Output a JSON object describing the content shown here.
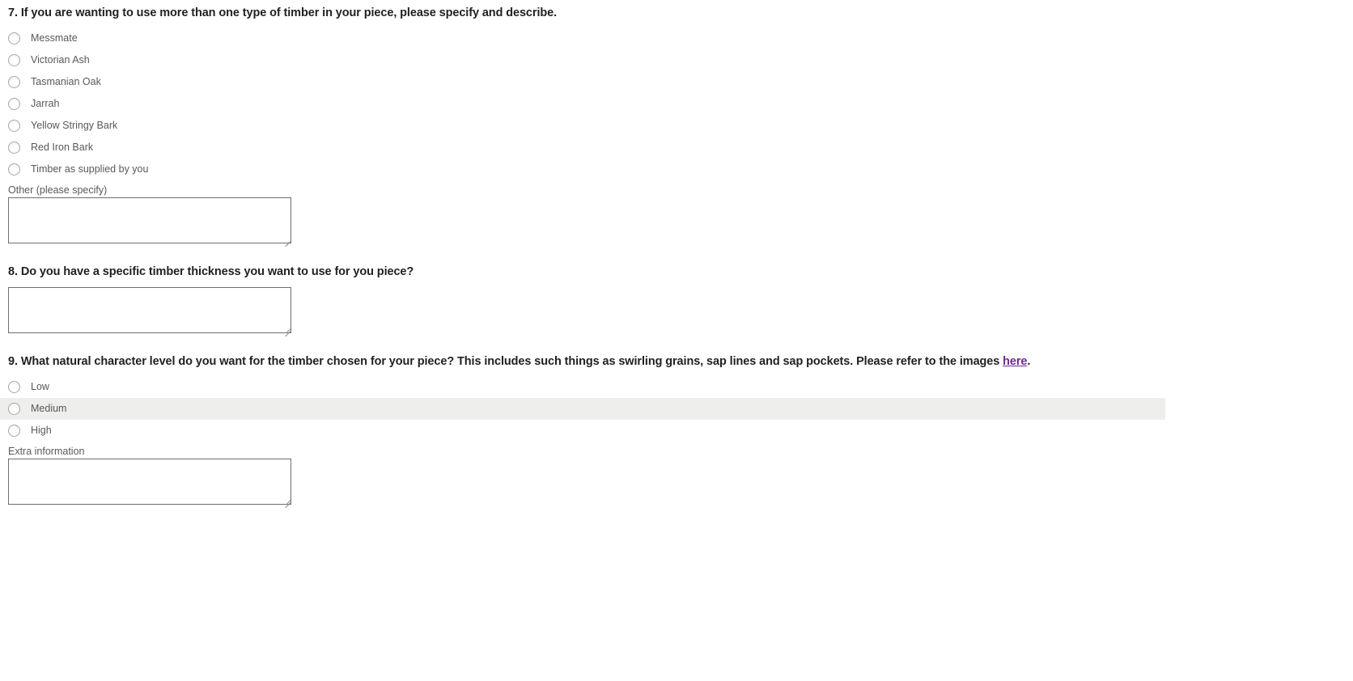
{
  "survey": {
    "questions": [
      {
        "number": "7.",
        "title": "7. If you are wanting to use more than one type of timber in your piece, please specify and describe.",
        "options": [
          {
            "label": "Messmate",
            "selected": false,
            "highlighted": false
          },
          {
            "label": "Victorian Ash",
            "selected": false,
            "highlighted": false
          },
          {
            "label": "Tasmanian Oak",
            "selected": false,
            "highlighted": false
          },
          {
            "label": "Jarrah",
            "selected": false,
            "highlighted": false
          },
          {
            "label": "Yellow Stringy Bark",
            "selected": false,
            "highlighted": false
          },
          {
            "label": "Red Iron Bark",
            "selected": false,
            "highlighted": false
          },
          {
            "label": "Timber as supplied by you",
            "selected": false,
            "highlighted": false
          }
        ],
        "other_label": "Other (please specify)",
        "other_value": "",
        "other_placeholder": ""
      },
      {
        "number": "8.",
        "title": "8. Do you have a specific timber thickness you want to use for you piece?",
        "answer_value": "",
        "answer_placeholder": ""
      },
      {
        "number": "9.",
        "title_part_1": "9. What natural character level do you want for the timber chosen for your piece? This includes such things as swirling grains, sap lines and sap pockets. Please refer to the images ",
        "link_text": "here",
        "title_part_2": ".",
        "options": [
          {
            "label": "Low",
            "selected": false,
            "highlighted": false
          },
          {
            "label": "Medium",
            "selected": false,
            "highlighted": true
          },
          {
            "label": "High",
            "selected": false,
            "highlighted": false
          }
        ],
        "extra_label": "Extra information",
        "extra_value": "",
        "extra_placeholder": ""
      }
    ]
  },
  "colors": {
    "heading_text": "#231f20",
    "option_text": "#58595b",
    "link_visited": "#6b2a8f",
    "row_hover_bg": "#eeeeec",
    "textarea_border": "#6d6e71",
    "radio_border": "#a6a6a6",
    "page_bg": "#ffffff"
  }
}
